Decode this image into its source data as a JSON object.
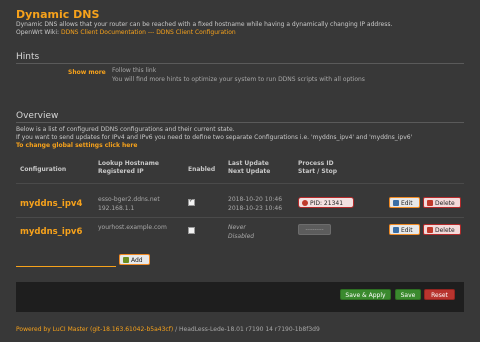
{
  "page": {
    "title": "Dynamic DNS",
    "desc_line1": "Dynamic DNS allows that your router can be reached with a fixed hostname while having a dynamically changing IP address.",
    "wiki_prefix": "OpenWrt Wiki: ",
    "wiki_link1": "DDNS Client Documentation",
    "wiki_sep": " --- ",
    "wiki_link2": "DDNS Client Configuration"
  },
  "hints": {
    "heading": "Hints",
    "show_more": "Show more",
    "follow": "Follow this link",
    "text": "You will find more hints to optimize your system to run DDNS scripts with all options"
  },
  "overview": {
    "heading": "Overview",
    "line1": "Below is a list of configured DDNS configurations and their current state.",
    "line2": "If you want to send updates for IPv4 and IPv6 you need to define two separate Configurations i.e. 'myddns_ipv4' and 'myddns_ipv6'",
    "global_link": "To change global settings click here"
  },
  "table": {
    "col_config": "Configuration",
    "col_lookup1": "Lookup Hostname",
    "col_lookup2": "Registered IP",
    "col_enabled": "Enabled",
    "col_last1": "Last Update",
    "col_last2": "Next Update",
    "col_proc1": "Process ID",
    "col_proc2": "Start / Stop",
    "rows": [
      {
        "name": "myddns_ipv4",
        "hostname": "esso-bger2.ddns.net",
        "ip": "192.168.1.1",
        "enabled": true,
        "last": "2018-10-20 10:46",
        "next": "2018-10-23 10:46",
        "pid": "PID: 21341",
        "edit": "Edit",
        "delete": "Delete"
      },
      {
        "name": "myddns_ipv6",
        "hostname": "yourhost.example.com",
        "ip": "",
        "enabled": false,
        "last": "Never",
        "next": "Disabled",
        "pid": "----------",
        "edit": "Edit",
        "delete": "Delete"
      }
    ]
  },
  "add": {
    "label": "Add"
  },
  "actions": {
    "save_apply": "Save & Apply",
    "save": "Save",
    "reset": "Reset"
  },
  "footer": {
    "link": "Powered by LuCI Master (git-18.163.61042-b5a43cf)",
    "rest": " / HeadLess-Lede-18.01 r7190 14 r7190-1b8f3d9"
  },
  "colors": {
    "accent": "#f7a21b",
    "background": "#383838"
  }
}
